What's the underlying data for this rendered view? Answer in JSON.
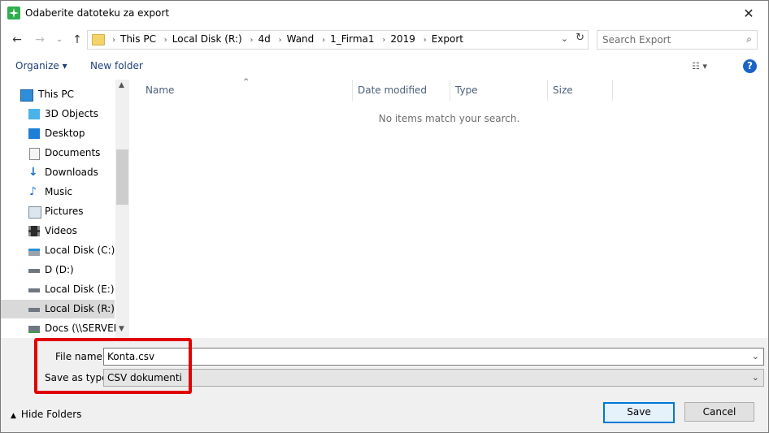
{
  "window": {
    "title": "Odaberite datoteku za export"
  },
  "nav": {
    "breadcrumb": [
      "This PC",
      "Local Disk (R:)",
      "4d",
      "Wand",
      "1_Firma1",
      "2019",
      "Export"
    ],
    "search_placeholder": "Search Export"
  },
  "toolbar": {
    "organize": "Organize ▾",
    "new_folder": "New folder",
    "help": "?"
  },
  "sidebar": {
    "items": [
      {
        "label": "This PC",
        "icon": "computer-icon"
      },
      {
        "label": "3D Objects",
        "icon": "cube-icon"
      },
      {
        "label": "Desktop",
        "icon": "desktop-icon"
      },
      {
        "label": "Documents",
        "icon": "document-icon"
      },
      {
        "label": "Downloads",
        "icon": "download-arrow-icon"
      },
      {
        "label": "Music",
        "icon": "music-note-icon"
      },
      {
        "label": "Pictures",
        "icon": "picture-icon"
      },
      {
        "label": "Videos",
        "icon": "film-icon"
      },
      {
        "label": "Local Disk (C:)",
        "icon": "drive-icon"
      },
      {
        "label": "D (D:)",
        "icon": "drive-icon"
      },
      {
        "label": "Local Disk (E:)",
        "icon": "drive-icon"
      },
      {
        "label": "Local Disk (R:)",
        "icon": "drive-icon",
        "selected": true
      },
      {
        "label": "Docs (\\\\SERVER-",
        "icon": "network-drive-icon"
      }
    ]
  },
  "columns": [
    "Name",
    "Date modified",
    "Type",
    "Size"
  ],
  "empty_message": "No items match your search.",
  "form": {
    "file_name_label": "File name:",
    "file_name_value": "Konta.csv",
    "save_type_label": "Save as type:",
    "save_type_value": "CSV dokumenti"
  },
  "footer": {
    "hide_folders": "Hide Folders",
    "save": "Save",
    "cancel": "Cancel"
  },
  "colors": {
    "accent": "#0078d7",
    "highlight": "#e00000",
    "link": "#1e3f7a"
  }
}
